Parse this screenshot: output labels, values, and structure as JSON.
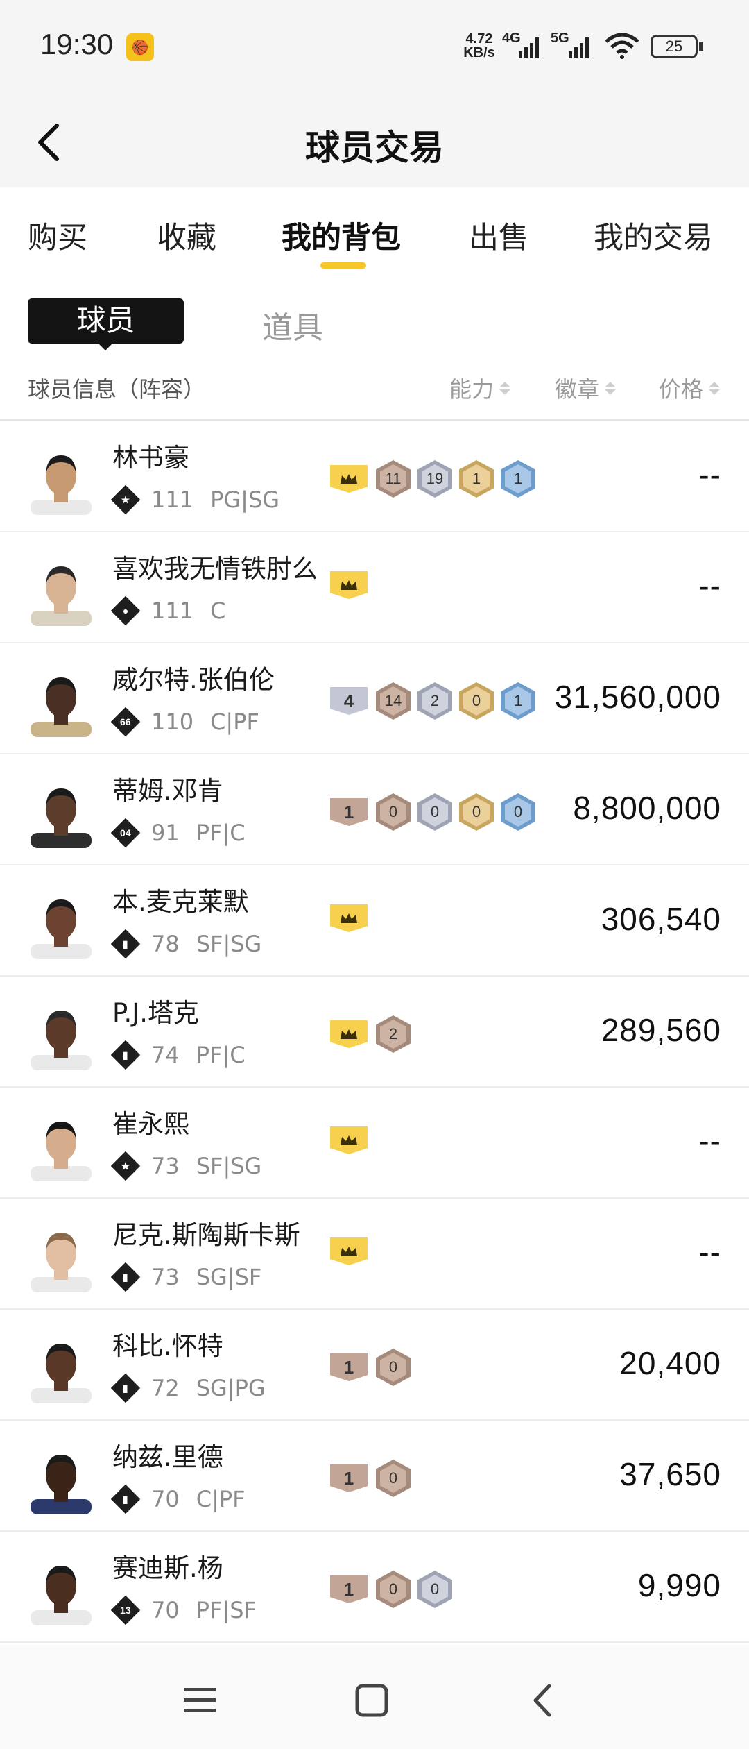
{
  "status_bar": {
    "time": "19:30",
    "app_icon_text": "🏀",
    "net_speed_value": "4.72",
    "net_speed_unit": "KB/s",
    "sim1": "4G",
    "sim2": "5G",
    "battery": "25"
  },
  "header": {
    "title": "球员交易",
    "back_icon": "back-chevron-icon"
  },
  "tabs": [
    {
      "label": "购买",
      "active": false
    },
    {
      "label": "收藏",
      "active": false
    },
    {
      "label": "我的背包",
      "active": true
    },
    {
      "label": "出售",
      "active": false
    },
    {
      "label": "我的交易",
      "active": false
    }
  ],
  "sub_tabs": {
    "player": "球员",
    "item": "道具"
  },
  "columns": {
    "info": "球员信息（阵容）",
    "ability": "能力",
    "badge": "徽章",
    "price": "价格"
  },
  "colors": {
    "accent": "#f7c72a",
    "crown": "#f7d04e"
  },
  "players": [
    {
      "name": "林书豪",
      "icon_text": "★",
      "rating": "111",
      "positions": "PG|SG",
      "crown": true,
      "tier": null,
      "hexes": [
        {
          "v": "11",
          "c": "bronze"
        },
        {
          "v": "19",
          "c": "silver"
        },
        {
          "v": "1",
          "c": "gold"
        },
        {
          "v": "1",
          "c": "blue"
        }
      ],
      "price": "--",
      "skin": "#c79a72",
      "hair": "#1b1b1b",
      "jersey": "#e9e9e9"
    },
    {
      "name": "喜欢我无情铁肘么",
      "icon_text": "●",
      "rating": "111",
      "positions": "C",
      "crown": true,
      "tier": null,
      "hexes": [],
      "price": "--",
      "skin": "#d8b393",
      "hair": "#2a2a2a",
      "jersey": "#d9d2c0"
    },
    {
      "name": "威尔特.张伯伦",
      "icon_text": "66",
      "rating": "110",
      "positions": "C|PF",
      "crown": false,
      "tier": {
        "v": "4",
        "c": "t-silver"
      },
      "hexes": [
        {
          "v": "14",
          "c": "bronze"
        },
        {
          "v": "2",
          "c": "silver"
        },
        {
          "v": "0",
          "c": "gold"
        },
        {
          "v": "1",
          "c": "blue"
        }
      ],
      "price": "31,560,000",
      "skin": "#4a3024",
      "hair": "#1a1a1a",
      "jersey": "#c9b48a"
    },
    {
      "name": "蒂姆.邓肯",
      "icon_text": "04",
      "rating": "91",
      "positions": "PF|C",
      "crown": false,
      "tier": {
        "v": "1",
        "c": "t-bronze"
      },
      "hexes": [
        {
          "v": "0",
          "c": "bronze"
        },
        {
          "v": "0",
          "c": "silver"
        },
        {
          "v": "0",
          "c": "gold"
        },
        {
          "v": "0",
          "c": "blue"
        }
      ],
      "price": "8,800,000",
      "skin": "#5c3d2c",
      "hair": "#1a1a1a",
      "jersey": "#2e2e2e"
    },
    {
      "name": "本.麦克莱默",
      "icon_text": "▮",
      "rating": "78",
      "positions": "SF|SG",
      "crown": true,
      "tier": null,
      "hexes": [],
      "price": "306,540",
      "skin": "#6b4330",
      "hair": "#1a1a1a",
      "jersey": "#e9e9e9"
    },
    {
      "name": "P.J.塔克",
      "icon_text": "▮",
      "rating": "74",
      "positions": "PF|C",
      "crown": true,
      "tier": null,
      "hexes": [
        {
          "v": "2",
          "c": "bronze"
        }
      ],
      "price": "289,560",
      "skin": "#5b3a2a",
      "hair": "#2a2a2a",
      "jersey": "#e9e9e9"
    },
    {
      "name": "崔永熙",
      "icon_text": "★",
      "rating": "73",
      "positions": "SF|SG",
      "crown": true,
      "tier": null,
      "hexes": [],
      "price": "--",
      "skin": "#d6ad8c",
      "hair": "#161616",
      "jersey": "#e9e9e9"
    },
    {
      "name": "尼克.斯陶斯卡斯",
      "icon_text": "▮",
      "rating": "73",
      "positions": "SG|SF",
      "crown": true,
      "tier": null,
      "hexes": [],
      "price": "--",
      "skin": "#e2bfa2",
      "hair": "#8a6a4a",
      "jersey": "#e9e9e9"
    },
    {
      "name": "科比.怀特",
      "icon_text": "▮",
      "rating": "72",
      "positions": "SG|PG",
      "crown": false,
      "tier": {
        "v": "1",
        "c": "t-bronze"
      },
      "hexes": [
        {
          "v": "0",
          "c": "bronze"
        }
      ],
      "price": "20,400",
      "skin": "#5a3828",
      "hair": "#1a1a1a",
      "jersey": "#e9e9e9"
    },
    {
      "name": "纳兹.里德",
      "icon_text": "▮",
      "rating": "70",
      "positions": "C|PF",
      "crown": false,
      "tier": {
        "v": "1",
        "c": "t-bronze"
      },
      "hexes": [
        {
          "v": "0",
          "c": "bronze"
        }
      ],
      "price": "37,650",
      "skin": "#3a2418",
      "hair": "#1a1a1a",
      "jersey": "#2b3a6b"
    },
    {
      "name": "赛迪斯.杨",
      "icon_text": "13",
      "rating": "70",
      "positions": "PF|SF",
      "crown": false,
      "tier": {
        "v": "1",
        "c": "t-bronze"
      },
      "hexes": [
        {
          "v": "0",
          "c": "bronze"
        },
        {
          "v": "0",
          "c": "silver"
        }
      ],
      "price": "9,990",
      "skin": "#4a2e20",
      "hair": "#1a1a1a",
      "jersey": "#e9e9e9"
    }
  ],
  "bottom_nav": {
    "menu_icon": "menu-icon",
    "home_icon": "home-square-icon",
    "back_icon": "back-icon"
  }
}
